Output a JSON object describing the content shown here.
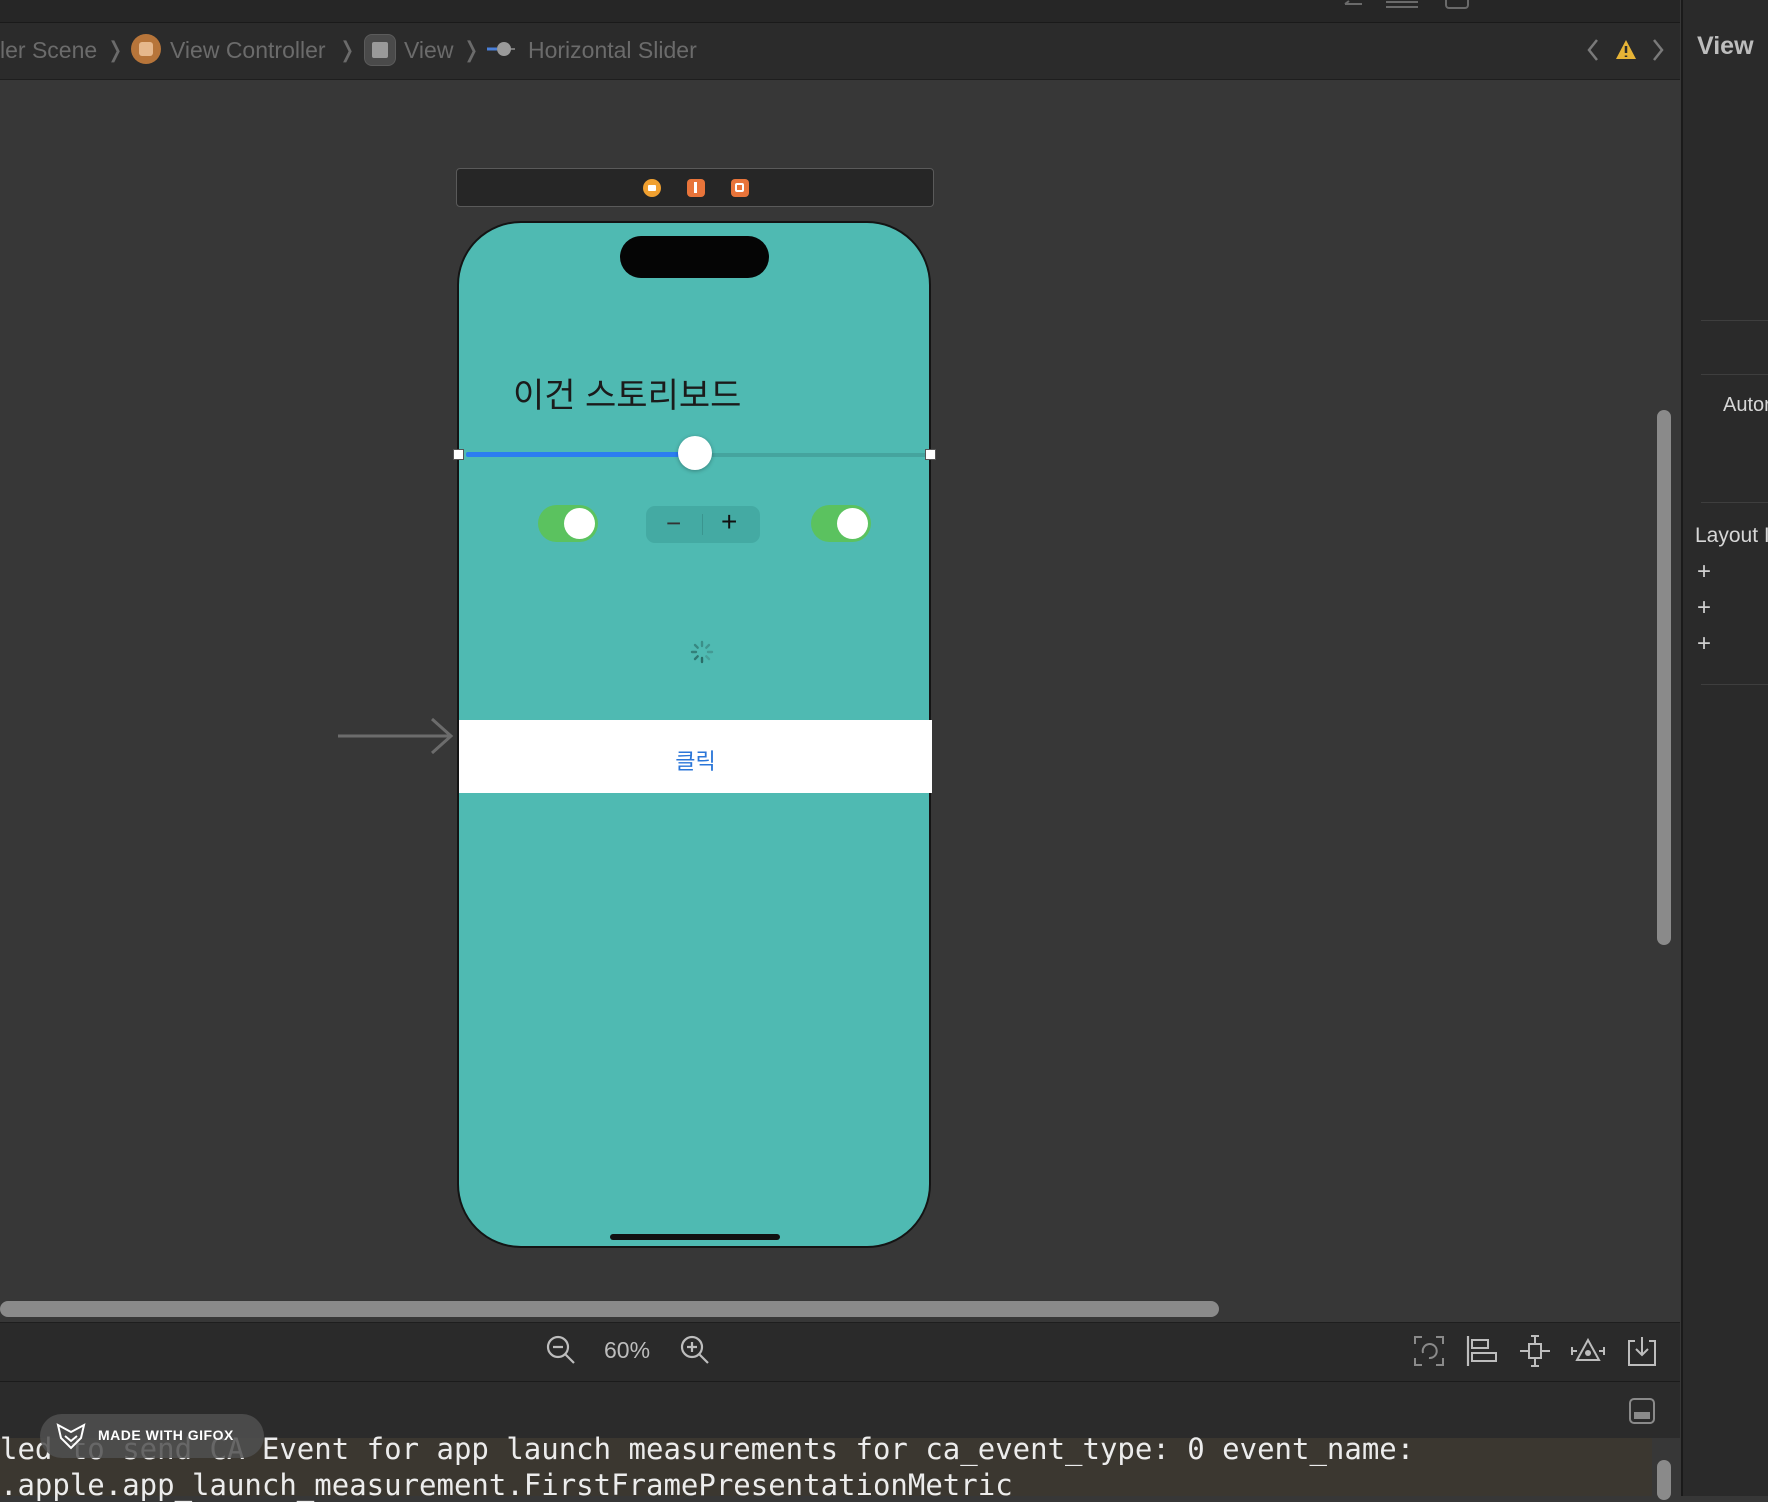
{
  "jumpbar": {
    "crumbs": [
      "ler Scene",
      "View Controller",
      "View",
      "Horizontal Slider"
    ],
    "separator": "❭"
  },
  "scene": {
    "title": "이건 스토리보드",
    "button_label": "클릭",
    "slider_value_fraction": 0.5,
    "stepper_minus": "−",
    "stepper_plus": "+",
    "switch_left_on": true,
    "switch_right_on": true
  },
  "toolbar": {
    "zoom": "60%"
  },
  "console": {
    "lines": [
      "led to send CA Event for app launch measurements for ca_event_type: 0 event_name:",
      ".apple.app_launch_measurement.FirstFramePresentationMetric"
    ]
  },
  "watermark": "MADE WITH GIFOX",
  "inspector": {
    "title": "View",
    "autoresizing": "Autor",
    "layout": "Layout I",
    "plus": "+"
  },
  "colors": {
    "phone_bg": "#4fbab2",
    "slider_fill": "#2c7df0",
    "switch_on": "#5bc25f",
    "button_text": "#2b76d8",
    "warning": "#e7b436"
  },
  "icons": [
    "scene-icon",
    "view-controller-icon",
    "view-icon",
    "slider-icon",
    "warning-icon",
    "zoom-out-icon",
    "zoom-in-icon",
    "update-frames-icon",
    "align-icon",
    "pin-icon",
    "resolve-issues-icon",
    "embed-icon",
    "console-toggle-icon"
  ]
}
